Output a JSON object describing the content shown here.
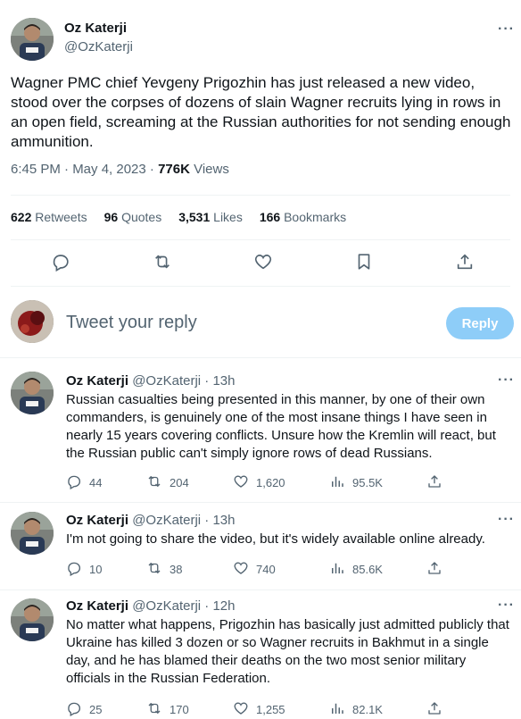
{
  "main_tweet": {
    "author_name": "Oz Katerji",
    "handle": "@OzKaterji",
    "text": "Wagner PMC chief Yevgeny Prigozhin has just released a new video, stood over the corpses of dozens of slain Wagner recruits lying in rows in an open field, screaming at the Russian authorities for not sending enough ammunition.",
    "time": "6:45 PM · May 4, 2023 · ",
    "views_count": "776K",
    "views_label": "Views",
    "stats": {
      "retweets_count": "622",
      "retweets_label": "Retweets",
      "quotes_count": "96",
      "quotes_label": "Quotes",
      "likes_count": "3,531",
      "likes_label": "Likes",
      "bookmarks_count": "166",
      "bookmarks_label": "Bookmarks"
    }
  },
  "composer": {
    "placeholder": "Tweet your reply",
    "reply_button": "Reply"
  },
  "replies": [
    {
      "author_name": "Oz Katerji",
      "meta": "@OzKaterji · 13h",
      "text": "Russian casualties being presented in this manner, by one of their own commanders, is genuinely one of the most insane things I have seen in nearly 15 years covering conflicts. Unsure how the Kremlin will react, but the Russian public can't simply ignore rows of dead Russians.",
      "replies": "44",
      "retweets": "204",
      "likes": "1,620",
      "views": "95.5K"
    },
    {
      "author_name": "Oz Katerji",
      "meta": "@OzKaterji · 13h",
      "text": "I'm not going to share the video, but it's widely available online already.",
      "replies": "10",
      "retweets": "38",
      "likes": "740",
      "views": "85.6K"
    },
    {
      "author_name": "Oz Katerji",
      "meta": "@OzKaterji · 12h",
      "text": "No matter what happens, Prigozhin has basically just admitted publicly that Ukraine has killed 3 dozen or so Wagner recruits in Bakhmut in a single day, and he has blamed their deaths on the two most senior military officials in the Russian Federation.",
      "replies": "25",
      "retweets": "170",
      "likes": "1,255",
      "views": "82.1K"
    }
  ],
  "more_label": "···",
  "colors": {
    "text": "#0f1419",
    "muted": "#536471",
    "reply_button_bg": "#8ecdf8",
    "divider": "#eff3f4"
  }
}
